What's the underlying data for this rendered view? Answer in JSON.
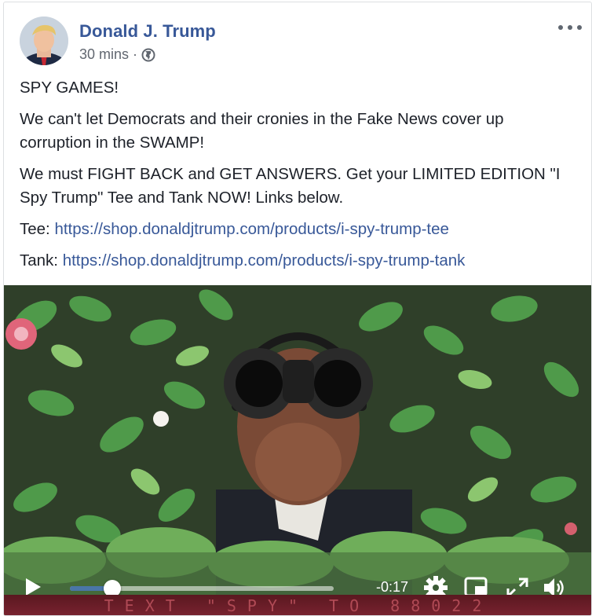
{
  "post": {
    "author": "Donald J. Trump",
    "timestamp": "30 mins",
    "separator": "·",
    "audience_icon": "globe-icon",
    "more_icon": "ellipsis-icon",
    "paragraphs": {
      "p1": "SPY GAMES!",
      "p2": "We can't let Democrats and their cronies in the Fake News cover up corruption in the SWAMP!",
      "p3": "We must FIGHT BACK and GET ANSWERS. Get your LIMITED EDITION \"I Spy Trump\" Tee and Tank NOW! Links below."
    },
    "links": {
      "tee_label": "Tee:",
      "tee_url": "https://shop.donaldjtrump.com/products/i-spy-trump-tee",
      "tank_label": "Tank:",
      "tank_url": "https://shop.donaldjtrump.com/products/i-spy-trump-tank"
    }
  },
  "video": {
    "promo_text": "TEXT \"SPY\" TO 88022",
    "time_remaining": "-0:17",
    "progress": 0.16,
    "icons": [
      "play-icon",
      "settings-icon",
      "picture-in-picture-icon",
      "fullscreen-icon",
      "volume-icon"
    ]
  },
  "colors": {
    "link": "#385898",
    "author": "#385898",
    "meta": "#616770",
    "progress_fill": "#4a76a8",
    "promo_bg": "#6a1f28"
  }
}
